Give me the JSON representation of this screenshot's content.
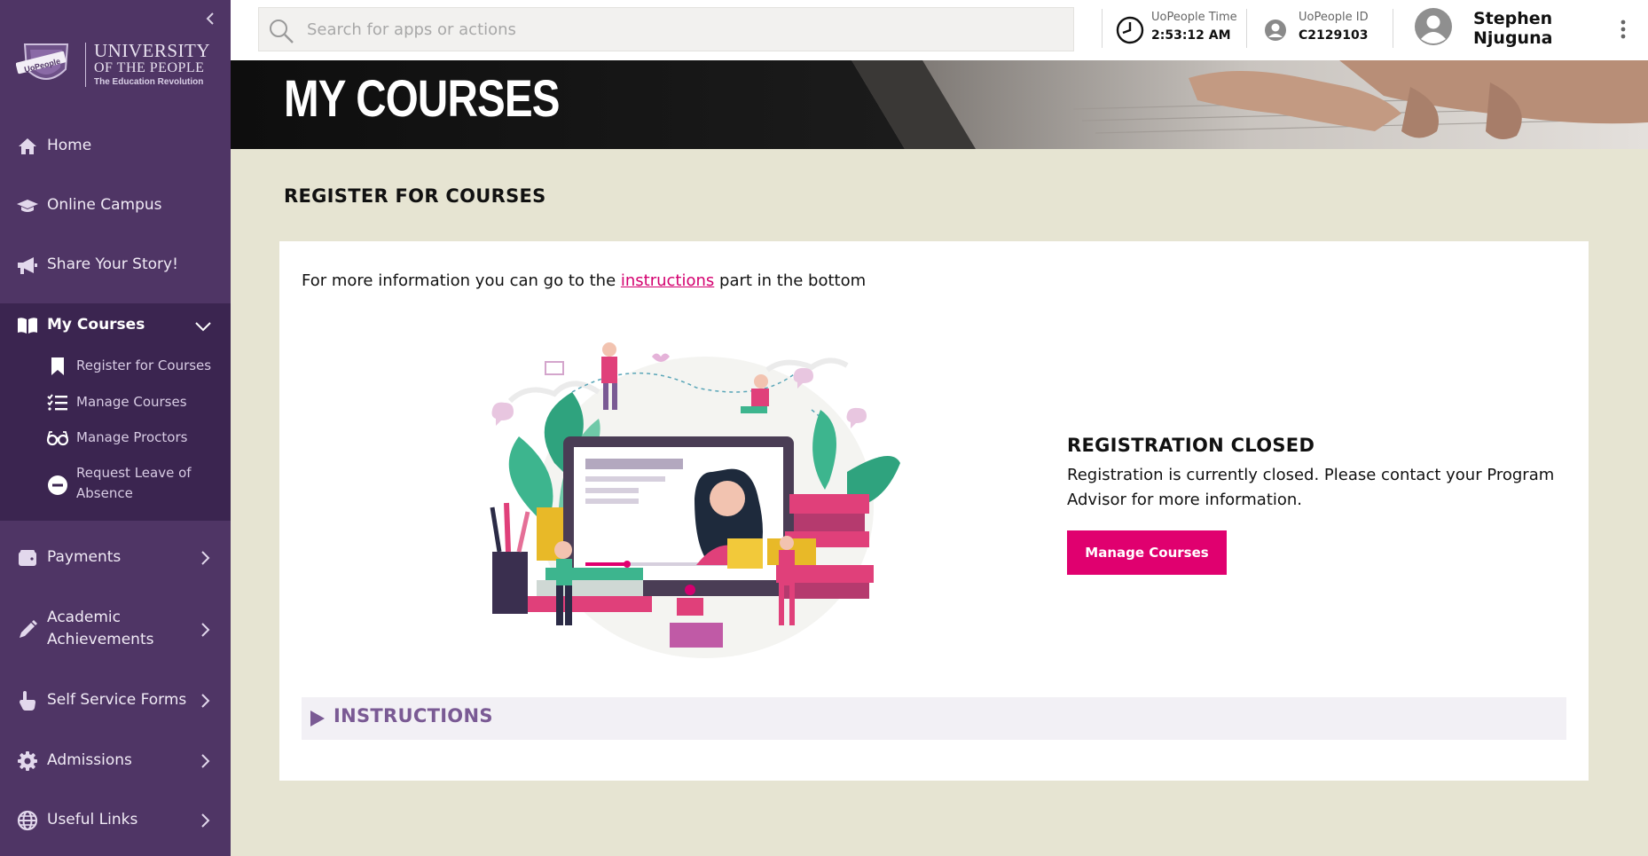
{
  "sidebar": {
    "logo": {
      "badge_text": "UoPeople",
      "line1": "UNIVERSITY",
      "line2": "OF THE PEOPLE",
      "line3": "The Education Revolution"
    },
    "items": [
      {
        "label": "Home",
        "icon": "home-icon"
      },
      {
        "label": "Online Campus",
        "icon": "graduation-cap-icon"
      },
      {
        "label": "Share Your Story!",
        "icon": "megaphone-icon"
      },
      {
        "label": "My Courses",
        "icon": "book-icon",
        "expanded": true
      },
      {
        "label": "Payments",
        "icon": "wallet-icon"
      },
      {
        "label": "Academic Achievements",
        "icon": "pencil-icon"
      },
      {
        "label": "Self Service Forms",
        "icon": "hand-pointer-icon"
      },
      {
        "label": "Admissions",
        "icon": "gear-icon"
      },
      {
        "label": "Useful Links",
        "icon": "globe-icon"
      }
    ],
    "my_courses_sub": [
      {
        "label": "Register for Courses",
        "icon": "bookmark-icon"
      },
      {
        "label": "Manage Courses",
        "icon": "checklist-icon"
      },
      {
        "label": "Manage Proctors",
        "icon": "glasses-icon"
      },
      {
        "label": "Request Leave of Absence",
        "icon": "minus-circle-icon"
      }
    ],
    "academic_line1": "Academic",
    "academic_line2": "Achievements",
    "leave_line1": "Request Leave of",
    "leave_line2": "Absence"
  },
  "topbar": {
    "search_placeholder": "Search for apps or actions",
    "time_label": "UoPeople Time",
    "time_value": "2:53:12 AM",
    "id_label": "UoPeople ID",
    "id_value": "C2129103",
    "user_first": "Stephen",
    "user_last": "Njuguna"
  },
  "banner": {
    "title": "MY COURSES"
  },
  "main": {
    "section_title": "REGISTER FOR COURSES",
    "info_before": "For more information you can go to the ",
    "info_link": "instructions",
    "info_after": " part in the bottom",
    "status_title": "REGISTRATION CLOSED",
    "status_text": "Registration is currently closed. Please contact your Program Advisor for more information.",
    "manage_button": "Manage Courses",
    "instructions_label": "INSTRUCTIONS"
  },
  "colors": {
    "sidebar_bg": "#4f3565",
    "submenu_bg": "#3b2550",
    "content_bg": "#e6e4d2",
    "accent": "#e0006f",
    "instructions_text": "#7a5a94"
  }
}
